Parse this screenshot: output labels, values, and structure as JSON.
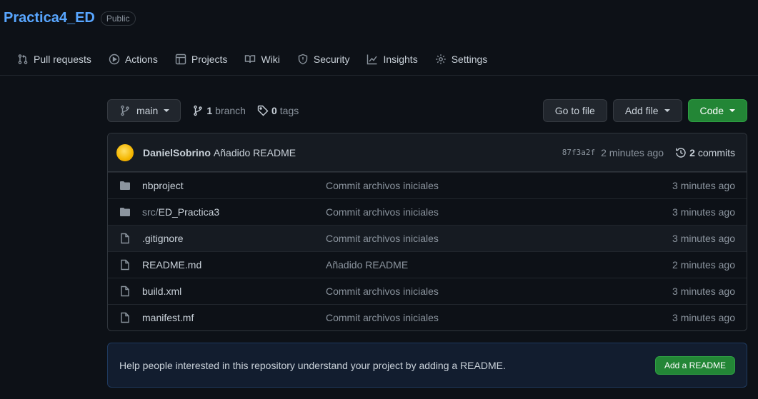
{
  "repo": {
    "name": "Practica4_ED",
    "visibility": "Public"
  },
  "nav": [
    {
      "label": "Pull requests",
      "icon": "pull-request-icon"
    },
    {
      "label": "Actions",
      "icon": "play-icon"
    },
    {
      "label": "Projects",
      "icon": "table-icon"
    },
    {
      "label": "Wiki",
      "icon": "book-icon"
    },
    {
      "label": "Security",
      "icon": "shield-icon"
    },
    {
      "label": "Insights",
      "icon": "graph-icon"
    },
    {
      "label": "Settings",
      "icon": "gear-icon"
    }
  ],
  "toolbar": {
    "branch": "main",
    "branches_count": "1",
    "branches_label": "branch",
    "tags_count": "0",
    "tags_label": "tags",
    "go_to_file": "Go to file",
    "add_file": "Add file",
    "code": "Code"
  },
  "commit": {
    "author": "DanielSobrino",
    "message": "Añadido README",
    "sha": "87f3a2f",
    "time": "2 minutes ago",
    "count": "2",
    "count_label": "commits"
  },
  "files": [
    {
      "type": "dir",
      "prefix": "",
      "name": "nbproject",
      "commit": "Commit archivos iniciales",
      "age": "3 minutes ago"
    },
    {
      "type": "dir",
      "prefix": "src/",
      "name": "ED_Practica3",
      "commit": "Commit archivos iniciales",
      "age": "3 minutes ago"
    },
    {
      "type": "file",
      "prefix": "",
      "name": ".gitignore",
      "commit": "Commit archivos iniciales",
      "age": "3 minutes ago"
    },
    {
      "type": "file",
      "prefix": "",
      "name": "README.md",
      "commit": "Añadido README",
      "age": "2 minutes ago"
    },
    {
      "type": "file",
      "prefix": "",
      "name": "build.xml",
      "commit": "Commit archivos iniciales",
      "age": "3 minutes ago"
    },
    {
      "type": "file",
      "prefix": "",
      "name": "manifest.mf",
      "commit": "Commit archivos iniciales",
      "age": "3 minutes ago"
    }
  ],
  "readme_banner": {
    "text": "Help people interested in this repository understand your project by adding a README.",
    "button": "Add a README"
  }
}
